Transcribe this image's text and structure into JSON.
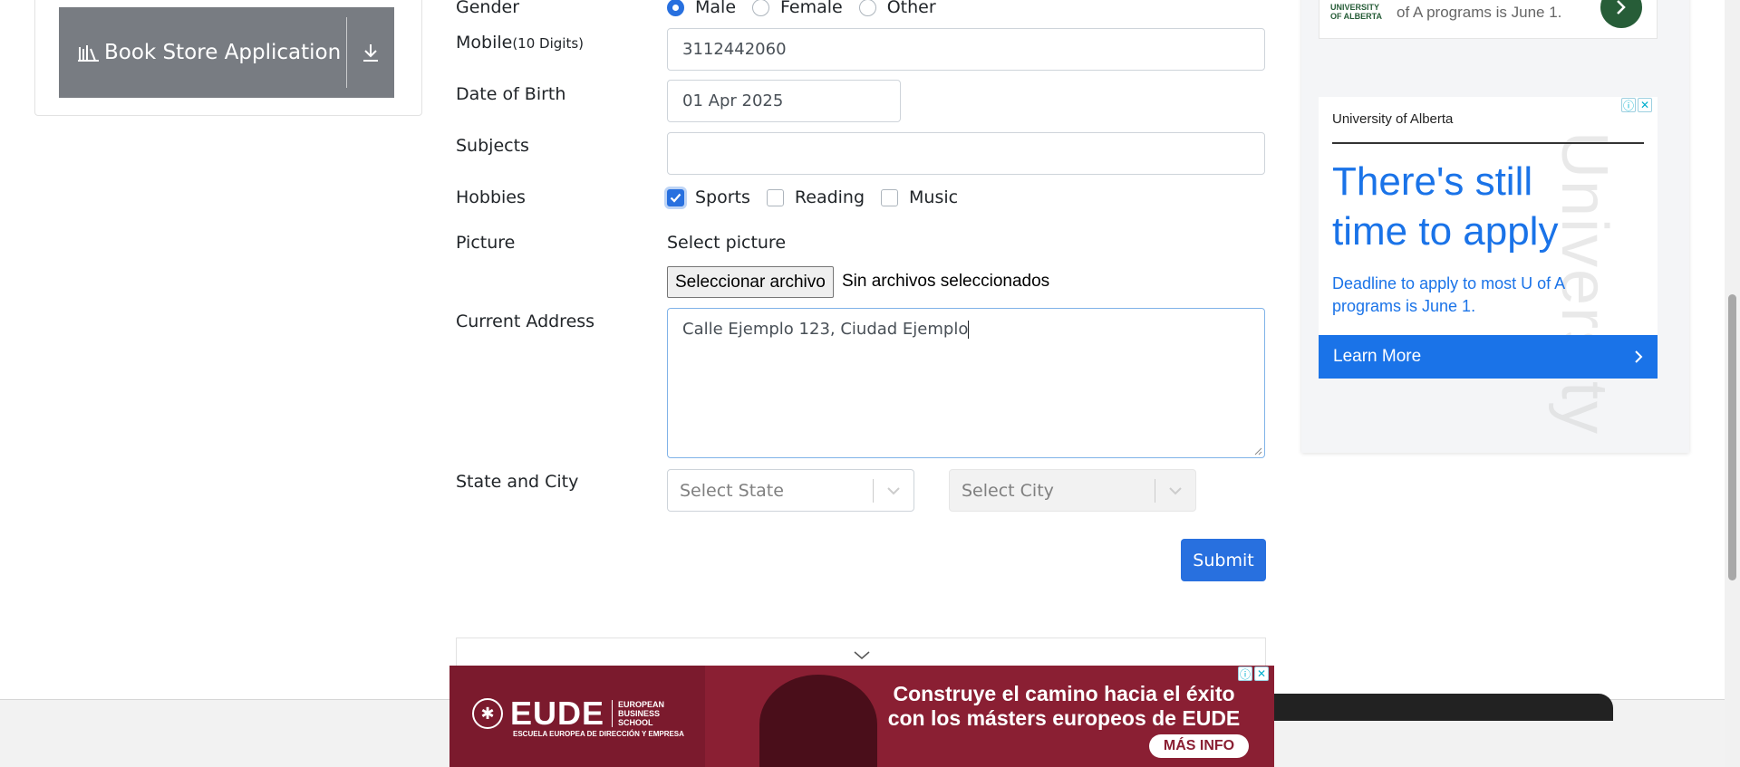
{
  "sidebar": {
    "book_store_label": "Book Store Application"
  },
  "form": {
    "gender": {
      "label": "Gender",
      "options": [
        "Male",
        "Female",
        "Other"
      ],
      "selected": "Male"
    },
    "mobile": {
      "label": "Mobile",
      "hint": "(10 Digits)",
      "value": "3112442060"
    },
    "dob": {
      "label": "Date of Birth",
      "value": "01 Apr 2025"
    },
    "subjects": {
      "label": "Subjects",
      "value": ""
    },
    "hobbies": {
      "label": "Hobbies",
      "options": [
        "Sports",
        "Reading",
        "Music"
      ],
      "checked": [
        "Sports"
      ]
    },
    "picture": {
      "label": "Picture",
      "prompt": "Select picture",
      "button": "Seleccionar archivo",
      "status": "Sin archivos seleccionados"
    },
    "address": {
      "label": "Current Address",
      "value": "Calle Ejemplo 123, Ciudad Ejemplo"
    },
    "state_city": {
      "label": "State and City",
      "state_placeholder": "Select State",
      "city_placeholder": "Select City"
    },
    "submit_label": "Submit"
  },
  "ads": {
    "top": {
      "logo": "UNIVERSITY OF ALBERTA",
      "text": "of A programs is June 1."
    },
    "main": {
      "org": "University of Alberta",
      "headline": "There's still time to apply",
      "subtext": "Deadline to apply to most U of A programs is June 1.",
      "cta": "Learn More",
      "watermark": "University"
    },
    "banner": {
      "brand": "EUDE",
      "brand_sub": "EUROPEAN BUSINESS SCHOOL",
      "tagline": "ESCUELA EUROPEA DE DIRECCIÓN Y EMPRESA",
      "message": "Construye el camino hacia el éxito con los másters europeos de EUDE",
      "cta": "MÁS INFO"
    }
  },
  "colors": {
    "primary": "#2870df",
    "sidebar_button": "#787c82",
    "ad_blue": "#1a73e8",
    "ua_green": "#275d38",
    "eude_red": "#7b1a2d"
  }
}
